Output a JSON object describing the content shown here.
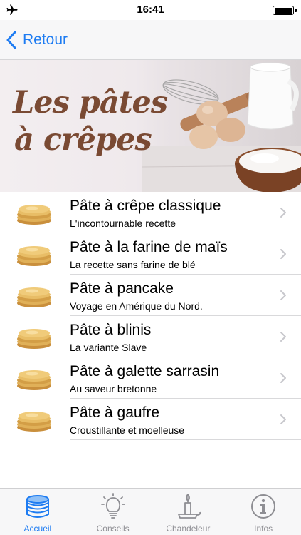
{
  "status_bar": {
    "time": "16:41",
    "icons": [
      "airplane-icon",
      "battery-icon"
    ]
  },
  "nav": {
    "back_label": "Retour",
    "accent_color": "#1e7cf2"
  },
  "banner": {
    "line1": "Les pâtes",
    "line2": "à crêpes"
  },
  "recipes": [
    {
      "title": "Pâte à crêpe classique",
      "subtitle": "L'incontournable recette"
    },
    {
      "title": "Pâte à la farine de maïs",
      "subtitle": "La recette sans farine de blé"
    },
    {
      "title": "Pâte à pancake",
      "subtitle": "Voyage en Amérique du Nord."
    },
    {
      "title": "Pâte à blinis",
      "subtitle": "La variante Slave"
    },
    {
      "title": "Pâte à galette sarrasin",
      "subtitle": "Au saveur bretonne"
    },
    {
      "title": "Pâte à gaufre",
      "subtitle": "Croustillante et moelleuse"
    }
  ],
  "tabs": [
    {
      "label": "Accueil",
      "icon": "crepe-stack-icon",
      "active": true
    },
    {
      "label": "Conseils",
      "icon": "lightbulb-icon",
      "active": false
    },
    {
      "label": "Chandeleur",
      "icon": "candle-icon",
      "active": false
    },
    {
      "label": "Infos",
      "icon": "info-icon",
      "active": false
    }
  ]
}
